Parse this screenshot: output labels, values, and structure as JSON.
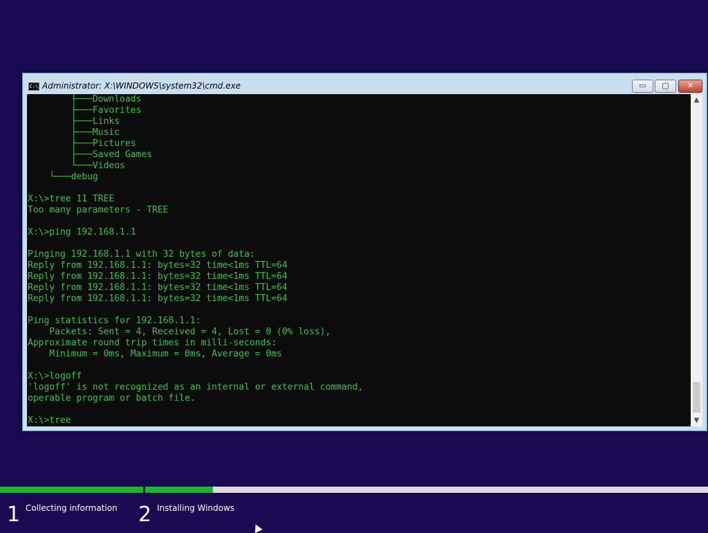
{
  "window": {
    "title": "Administrator: X:\\WINDOWS\\system32\\cmd.exe",
    "icon_text": "C:\\",
    "minimize_label": "▭",
    "maximize_label": "▢",
    "close_label": "✕"
  },
  "console": {
    "lines": [
      "        ├───Downloads",
      "        ├───Favorites",
      "        ├───Links",
      "        ├───Music",
      "        ├───Pictures",
      "        ├───Saved Games",
      "        └───Videos",
      "    └───debug",
      "",
      "X:\\>tree 11 TREE",
      "Too many parameters - TREE",
      "",
      "X:\\>ping 192.168.1.1",
      "",
      "Pinging 192.168.1.1 with 32 bytes of data:",
      "Reply from 192.168.1.1: bytes=32 time<1ms TTL=64",
      "Reply from 192.168.1.1: bytes=32 time<1ms TTL=64",
      "Reply from 192.168.1.1: bytes=32 time<1ms TTL=64",
      "Reply from 192.168.1.1: bytes=32 time<1ms TTL=64",
      "",
      "Ping statistics for 192.168.1.1:",
      "    Packets: Sent = 4, Received = 4, Lost = 0 (0% loss),",
      "Approximate round trip times in milli-seconds:",
      "    Minimum = 0ms, Maximum = 0ms, Average = 0ms",
      "",
      "X:\\>logoff",
      "'logoff' is not recognized as an internal or external command,",
      "operable program or batch file.",
      "",
      "X:\\>tree"
    ],
    "text_color": "#3cc24a",
    "background": "#0c0c0c"
  },
  "scrollbar": {
    "up_arrow": "▲",
    "down_arrow": "▼"
  },
  "setup": {
    "steps": [
      {
        "number": "1",
        "label": "Collecting information",
        "progress": 1.0
      },
      {
        "number": "2",
        "label": "Installing Windows",
        "progress": 0.12
      }
    ],
    "accent_color": "#1db532",
    "background": "#1a0a52"
  }
}
